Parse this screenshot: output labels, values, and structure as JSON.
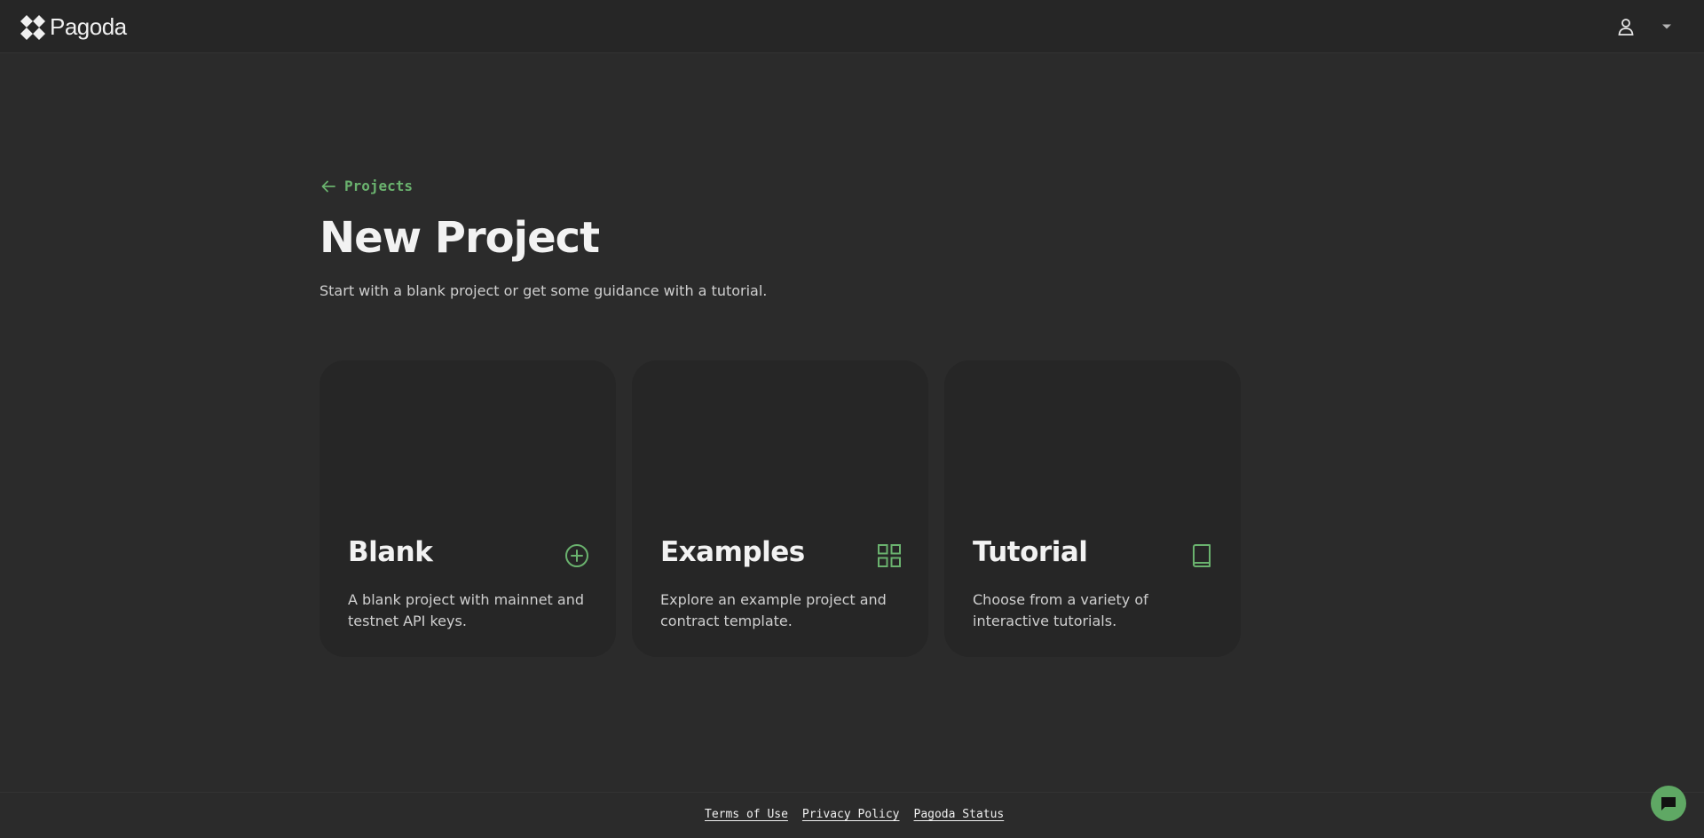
{
  "header": {
    "logo_text": "Pagoda",
    "user_icon": "user-icon",
    "menu_icon": "caret-down-icon"
  },
  "main": {
    "back_link": "Projects",
    "title": "New Project",
    "subtitle": "Start with a blank project or get some guidance with a tutorial."
  },
  "cards": [
    {
      "title": "Blank",
      "description": "A blank project with mainnet and testnet API keys.",
      "icon": "plus-circle-icon"
    },
    {
      "title": "Examples",
      "description": "Explore an example project and contract template.",
      "icon": "grid-icon"
    },
    {
      "title": "Tutorial",
      "description": "Choose from a variety of interactive tutorials.",
      "icon": "book-icon"
    }
  ],
  "footer": {
    "links": [
      "Terms of Use",
      "Privacy Policy",
      "Pagoda Status"
    ]
  },
  "colors": {
    "accent": "#6ab26e",
    "background": "#2b2b2b",
    "card": "#262626",
    "chat_button": "#5fa864"
  }
}
